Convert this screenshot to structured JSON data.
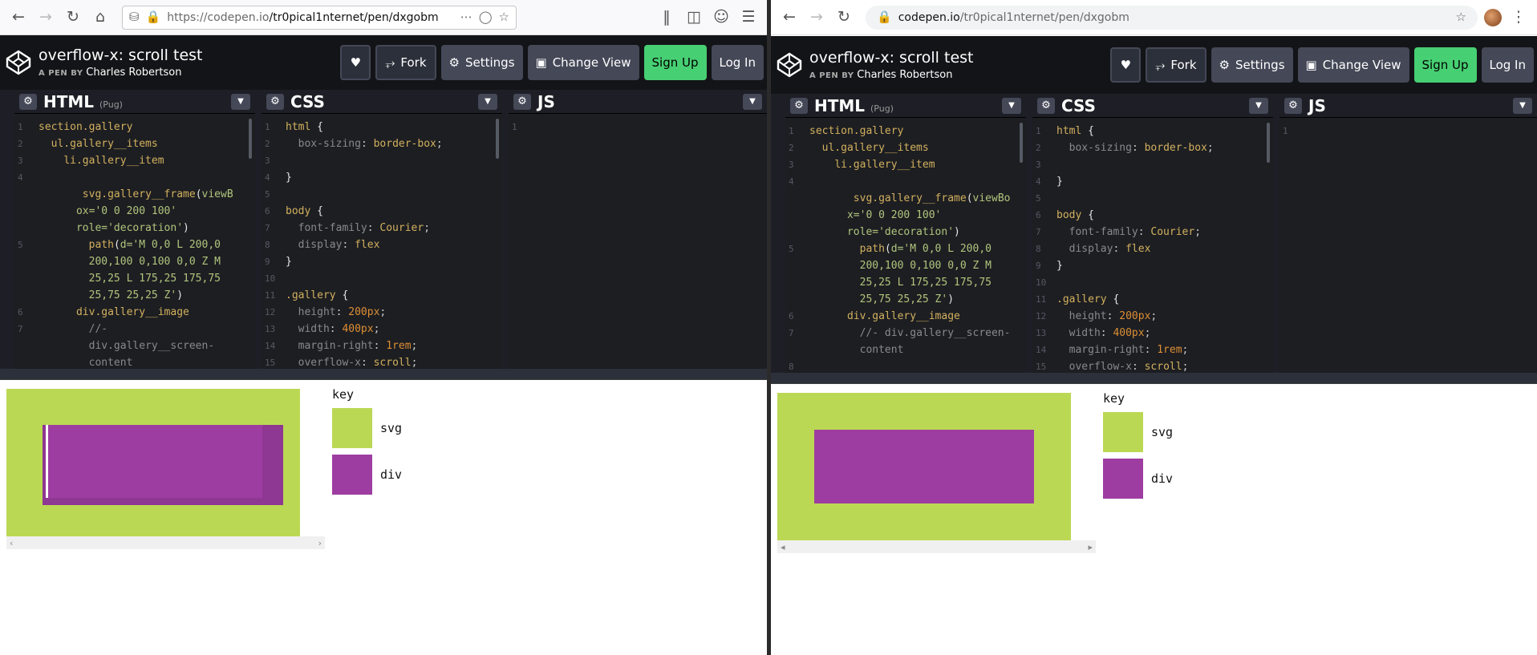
{
  "browserL": {
    "url_domain": "https://codepen.io",
    "url_path": "/tr0pical1nternet/pen/dxgobm"
  },
  "browserR": {
    "url_domain": "codepen.io",
    "url_path": "/tr0pical1nternet/pen/dxgobm"
  },
  "pen": {
    "title": "overflow-x: scroll test",
    "by_prefix": "A PEN BY",
    "author": "Charles Robertson"
  },
  "buttons": {
    "fork": "Fork",
    "settings": "Settings",
    "change_view": "Change View",
    "sign_up": "Sign Up",
    "log_in": "Log In"
  },
  "panes": {
    "html": "HTML",
    "html_tag": "(Pug)",
    "css": "CSS",
    "js": "JS"
  },
  "key": {
    "title": "key",
    "svg": "svg",
    "div": "div"
  },
  "colors": {
    "svg": "#bbd854",
    "div": "#9e3da1",
    "signup": "#47cf73",
    "bar": "#131417"
  }
}
